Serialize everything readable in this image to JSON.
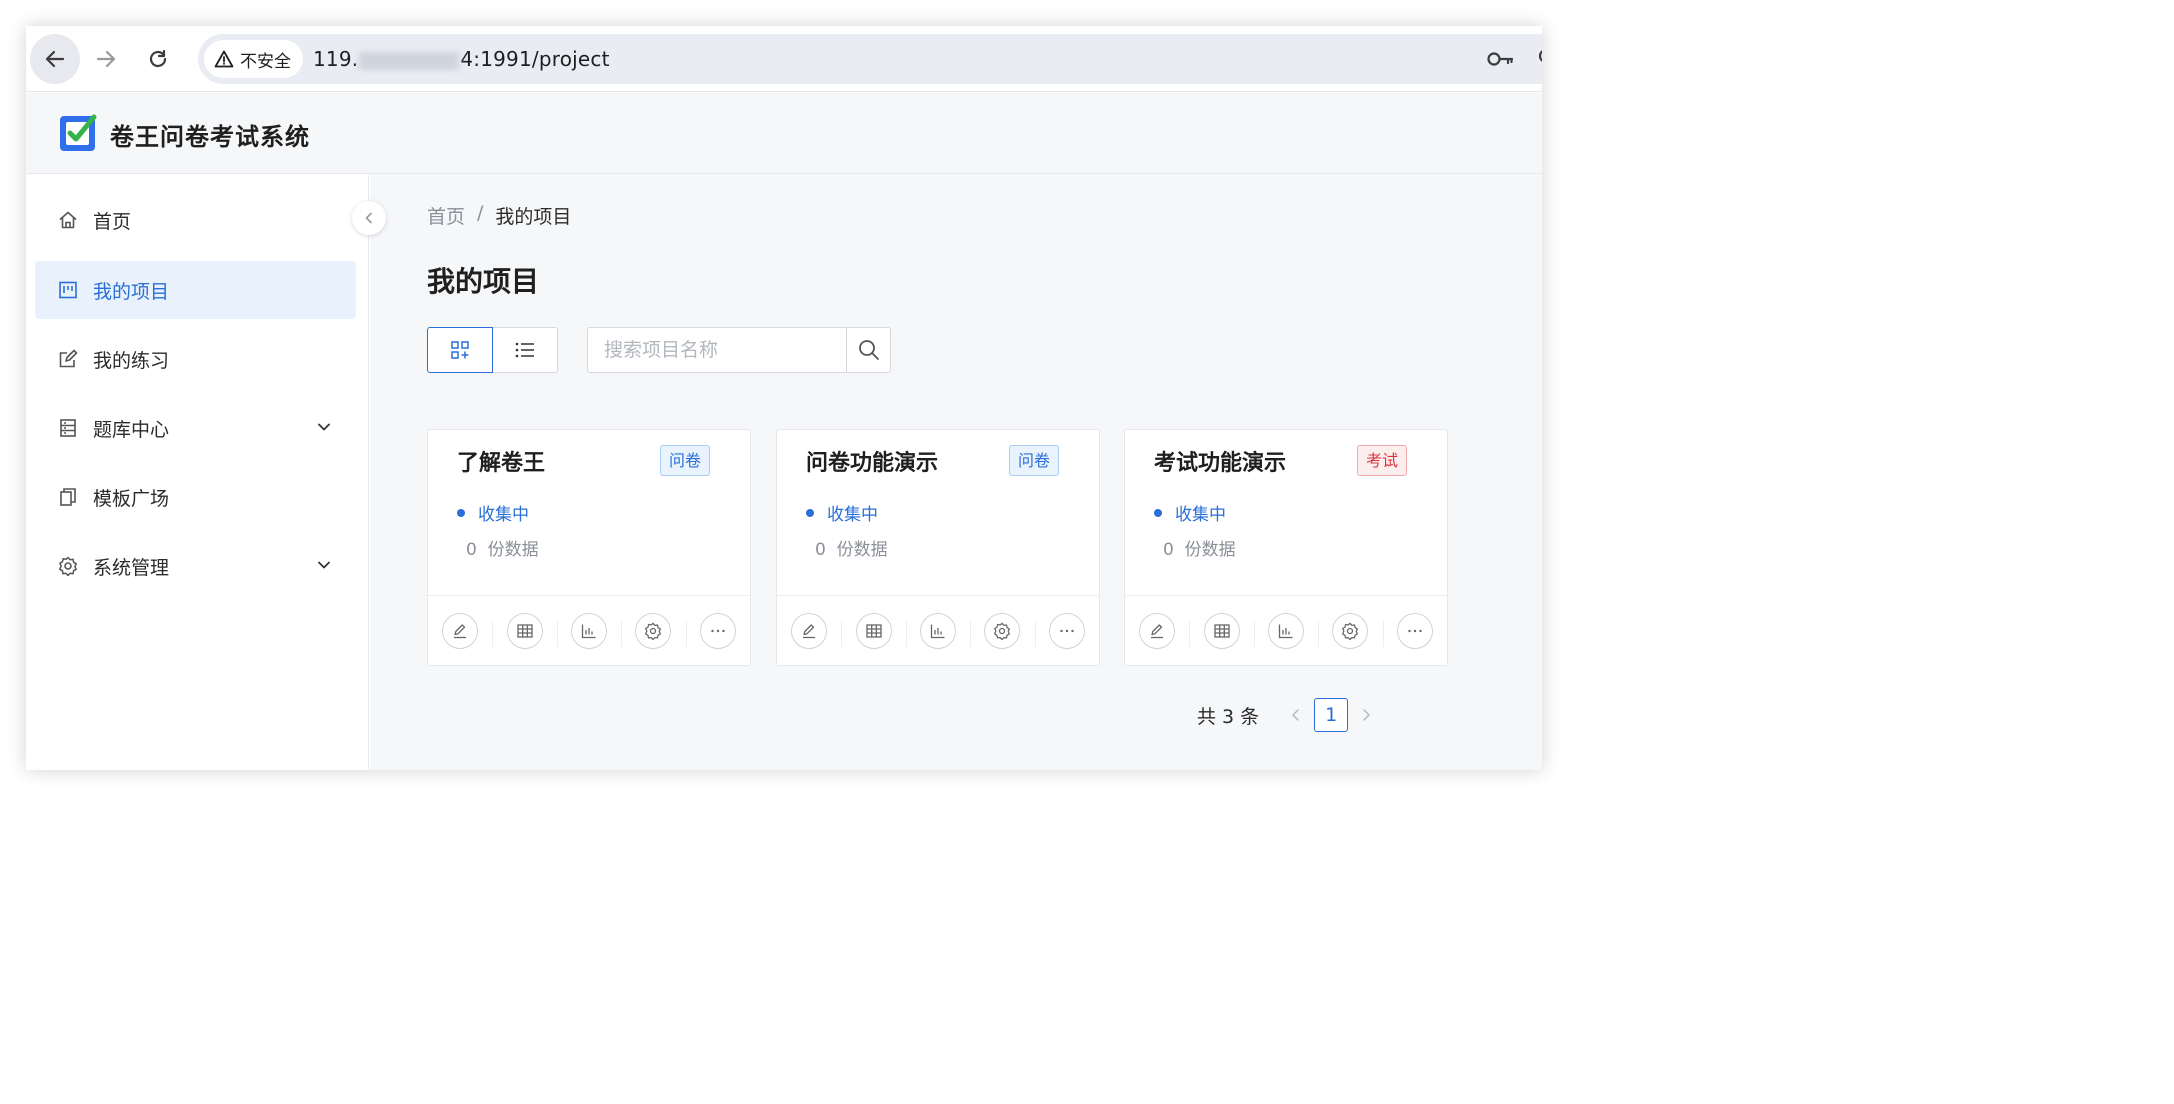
{
  "browser": {
    "security_label": "不安全",
    "url_prefix": "119.",
    "url_suffix": "4:1991/project"
  },
  "app": {
    "title": "卷王问卷考试系统"
  },
  "sidebar": {
    "items": [
      {
        "label": "首页",
        "icon": "home-icon"
      },
      {
        "label": "我的项目",
        "icon": "project-icon",
        "active": true
      },
      {
        "label": "我的练习",
        "icon": "edit-icon"
      },
      {
        "label": "题库中心",
        "icon": "question-bank-icon",
        "expandable": true
      },
      {
        "label": "模板广场",
        "icon": "template-icon"
      },
      {
        "label": "系统管理",
        "icon": "gear-icon",
        "expandable": true
      }
    ]
  },
  "breadcrumb": {
    "home": "首页",
    "separator": "/",
    "current": "我的项目"
  },
  "page": {
    "title": "我的项目"
  },
  "search": {
    "placeholder": "搜索项目名称"
  },
  "cards": [
    {
      "title": "了解卷王",
      "tag": "问卷",
      "tag_type": "survey",
      "status": "收集中",
      "count": "0",
      "count_unit": "份数据"
    },
    {
      "title": "问卷功能演示",
      "tag": "问卷",
      "tag_type": "survey",
      "status": "收集中",
      "count": "0",
      "count_unit": "份数据"
    },
    {
      "title": "考试功能演示",
      "tag": "考试",
      "tag_type": "exam",
      "status": "收集中",
      "count": "0",
      "count_unit": "份数据"
    }
  ],
  "card_actions": [
    "edit-icon",
    "table-icon",
    "chart-icon",
    "settings-icon",
    "more-icon"
  ],
  "pagination": {
    "total_text": "共 3 条",
    "current_page": "1"
  },
  "colors": {
    "accent": "#2a6fd8",
    "exam_tag": "#d9363e",
    "logo_blue": "#2f6fea",
    "logo_check": "#35b34a"
  }
}
